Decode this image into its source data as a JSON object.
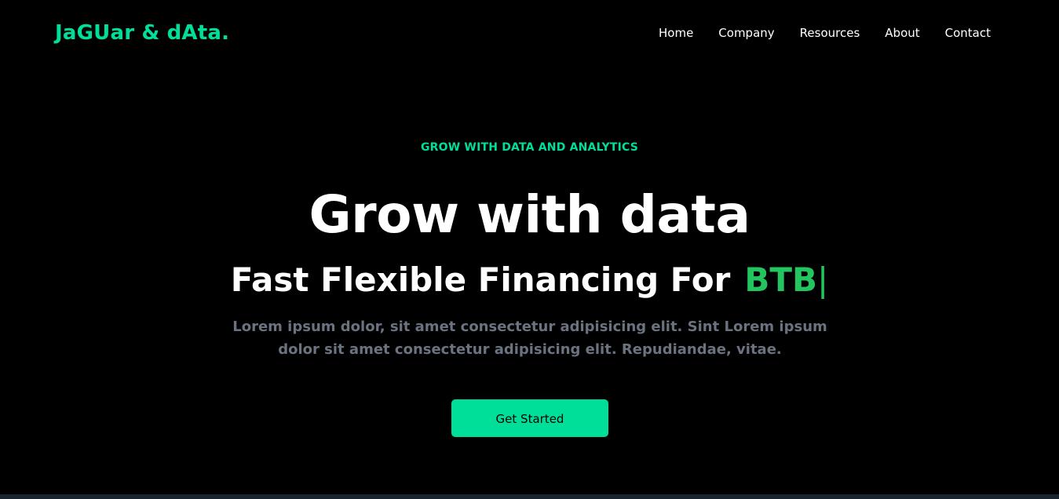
{
  "header": {
    "logo": "JaGUar & dAta.",
    "nav": [
      {
        "label": "Home"
      },
      {
        "label": "Company"
      },
      {
        "label": "Resources"
      },
      {
        "label": "About"
      },
      {
        "label": "Contact"
      }
    ]
  },
  "hero": {
    "eyebrow": "GROW WITH DATA AND ANALYTICS",
    "headline": "Grow with data",
    "subhead_prefix": "Fast Flexible Financing For",
    "subhead_typed": "BTB",
    "cursor": "|",
    "lede": "Lorem ipsum dolor, sit amet consectetur adipisicing elit. Sint Lorem ipsum dolor sit amet consectetur adipisicing elit. Repudiandae, vitae.",
    "cta_label": "Get Started"
  },
  "colors": {
    "background": "#000000",
    "accent": "#00df9a",
    "typed_accent": "#22c55e",
    "muted_text": "#6b7280"
  }
}
